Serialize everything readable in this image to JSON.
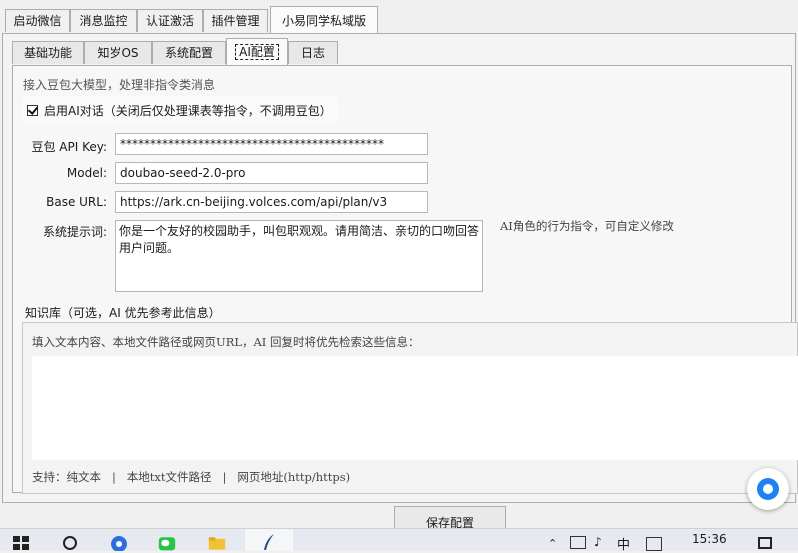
{
  "outer_tabs": [
    "启动微信",
    "消息监控",
    "认证激活",
    "插件管理",
    "小易同学私域版"
  ],
  "inner_tabs": [
    "基础功能",
    "知岁OS",
    "系统配置",
    "AI配置",
    "日志"
  ],
  "ai": {
    "description": "接入豆包大模型，处理非指令类消息",
    "enable_label": "启用AI对话（关闭后仅处理课表等指令，不调用豆包）",
    "api_key_label": "豆包 API Key:",
    "api_key_value": "********************************************",
    "model_label": "Model:",
    "model_value": "doubao-seed-2.0-pro",
    "base_url_label": "Base URL:",
    "base_url_value": "https://ark.cn-beijing.volces.com/api/plan/v3",
    "prompt_label": "系统提示词:",
    "prompt_value": "你是一个友好的校园助手，叫包职观观。请用简洁、亲切的口吻回答用户问题。",
    "prompt_hint": "AI角色的行为指令，可自定义修改"
  },
  "kb": {
    "title": "知识库（可选，AI 优先参考此信息）",
    "placeholder": "填入文本内容、本地文件路径或网页URL，AI 回复时将优先检索这些信息：",
    "support": "支持：纯文本   |   本地txt文件路径   |   网页地址(http/https)"
  },
  "save_label": "保存配置",
  "taskbar": {
    "time": "15:36",
    "ime": "中"
  }
}
